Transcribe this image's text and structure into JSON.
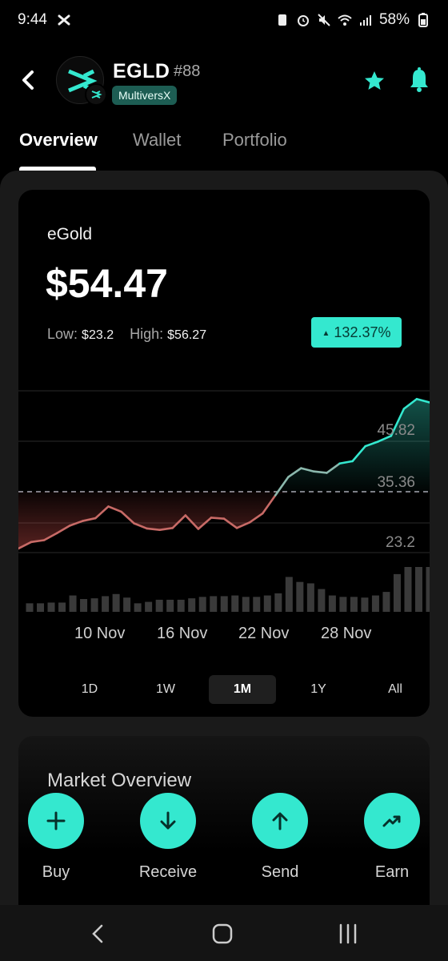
{
  "status_bar": {
    "time": "9:44",
    "battery": "58%"
  },
  "header": {
    "symbol": "EGLD",
    "rank": "#88",
    "chain": "MultiversX"
  },
  "tabs": [
    {
      "label": "Overview"
    },
    {
      "label": "Wallet"
    },
    {
      "label": "Portfolio"
    }
  ],
  "overview": {
    "coin_name": "eGold",
    "price": "$54.47",
    "low_label": "Low:",
    "low_value": "$23.2",
    "high_label": "High:",
    "high_value": "$56.27",
    "change": "132.37%"
  },
  "chart_data": {
    "type": "line",
    "x_ticks": [
      "10 Nov",
      "16 Nov",
      "22 Nov",
      "28 Nov"
    ],
    "y_ticks": [
      "45.82",
      "35.36",
      "23.2"
    ],
    "reference_line": 35.36,
    "series": [
      {
        "values": [
          23.2,
          24.6,
          25.0,
          26.5,
          28.1,
          29.1,
          29.7,
          32.2,
          31.1,
          28.6,
          27.5,
          27.2,
          27.6,
          30.3,
          27.4,
          29.8,
          29.6,
          27.6,
          28.8,
          30.7,
          34.6,
          38.5,
          40.4,
          39.7,
          39.4,
          41.4,
          41.9,
          45.1,
          46.1,
          47.3,
          53.1,
          55.2,
          54.47
        ]
      }
    ],
    "volume": [
      1.2,
      1.2,
      1.3,
      1.3,
      2.3,
      1.8,
      1.9,
      2.2,
      2.5,
      2.0,
      1.2,
      1.4,
      1.7,
      1.7,
      1.7,
      1.9,
      2.1,
      2.2,
      2.2,
      2.3,
      2.1,
      2.1,
      2.3,
      2.6,
      4.9,
      4.2,
      4.0,
      3.2,
      2.3,
      2.1,
      2.1,
      2.0,
      2.3,
      2.8,
      5.3,
      6.3,
      6.3,
      6.3
    ],
    "grid": true
  },
  "timeframes": [
    {
      "label": "1D"
    },
    {
      "label": "1W"
    },
    {
      "label": "1M"
    },
    {
      "label": "1Y"
    },
    {
      "label": "All"
    }
  ],
  "market": {
    "title": "Market Overview"
  },
  "actions": [
    {
      "label": "Buy"
    },
    {
      "label": "Receive"
    },
    {
      "label": "Send"
    },
    {
      "label": "Earn"
    }
  ],
  "colors": {
    "accent": "#34e8cf",
    "down": "#d9534f",
    "background": "#000000"
  }
}
